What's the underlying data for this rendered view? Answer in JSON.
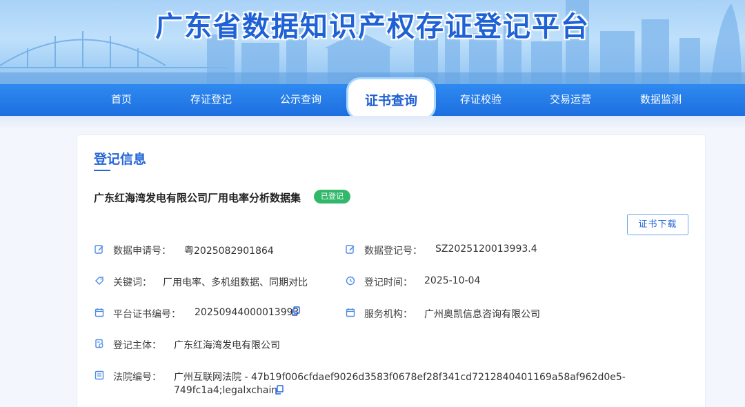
{
  "banner": {
    "title": "广东省数据知识产权存证登记平台"
  },
  "nav": {
    "items": [
      {
        "label": "首页"
      },
      {
        "label": "存证登记"
      },
      {
        "label": "公示查询"
      },
      {
        "label": "证书查询"
      },
      {
        "label": "存证校验"
      },
      {
        "label": "交易运营"
      },
      {
        "label": "数据监测"
      }
    ],
    "active_index": 3
  },
  "colors": {
    "primary": "#2566d8",
    "nav": "#1d6fe0",
    "badge": "#33b86b"
  },
  "record": {
    "section_title": "登记信息",
    "dataset_name": "广东红海湾发电有限公司厂用电率分析数据集",
    "status": "已登记",
    "download_label": "证书下载",
    "fields": {
      "application_no": {
        "label": "数据申请号：",
        "value": "粤2025082901864",
        "icon": "edit-icon"
      },
      "registration_no": {
        "label": "数据登记号：",
        "value": "SZ2025120013993.4",
        "icon": "edit-icon"
      },
      "keywords": {
        "label": "关键词：",
        "value": "厂用电率、多机组数据、同期对比",
        "icon": "tag-icon"
      },
      "registration_time": {
        "label": "登记时间：",
        "value": "2025-10-04",
        "icon": "clock-icon"
      },
      "certificate_no": {
        "label": "平台证书编号：",
        "value": "20250944000013993",
        "icon": "calendar-icon"
      },
      "service_org": {
        "label": "服务机构：",
        "value": "广州奥凯信息咨询有限公司",
        "icon": "calendar-icon"
      },
      "registrant": {
        "label": "登记主体：",
        "value": "广东红海湾发电有限公司",
        "icon": "entity-icon"
      },
      "court_no": {
        "label": "法院编号：",
        "value_line1": "广州互联网法院 - 47b19f006cfdaef9026d3583f0678ef28f341cd7212840401169a58af962d0e5-",
        "value_line2": "749fc1a4;legalxchain",
        "icon": "document-icon"
      }
    }
  }
}
